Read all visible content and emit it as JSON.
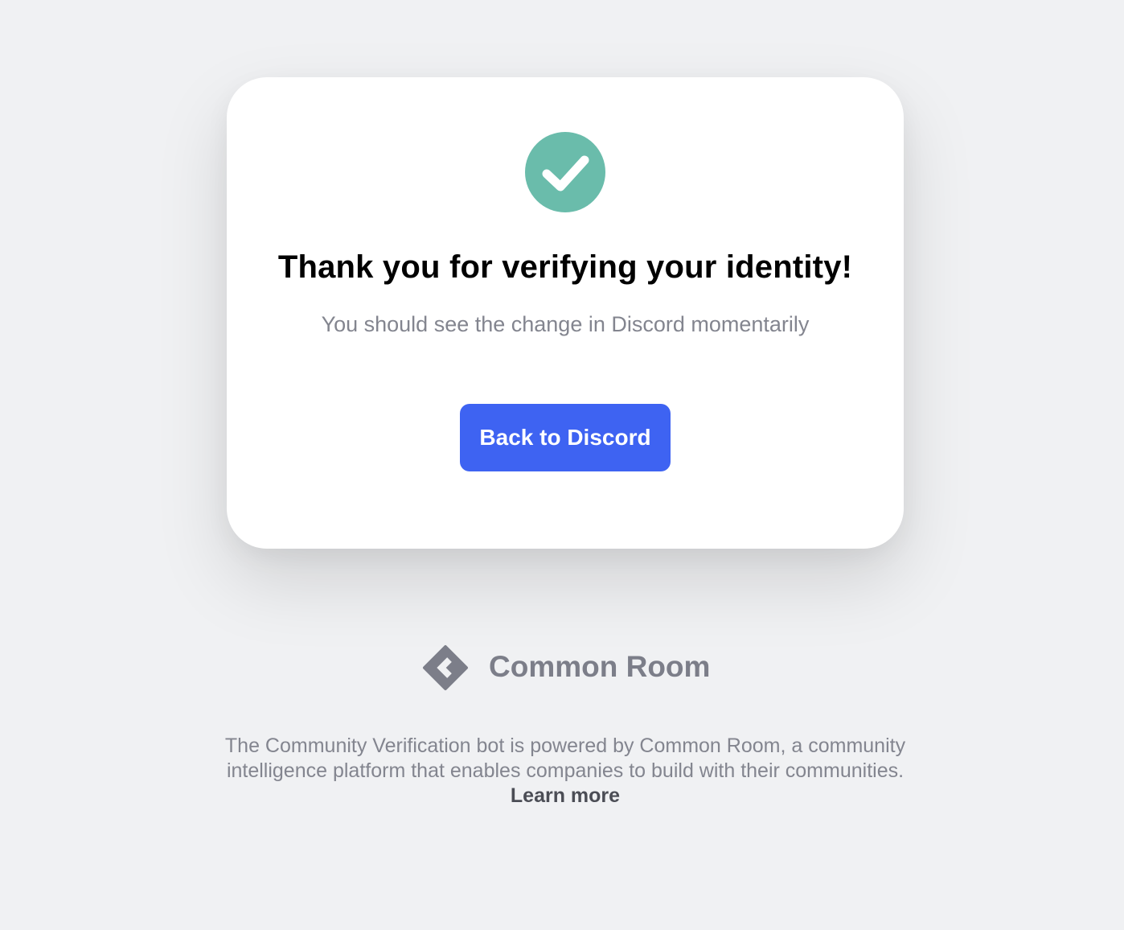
{
  "card": {
    "title": "Thank you for verifying your identity!",
    "subtitle": "You should see the change in Discord momentarily",
    "button_label": "Back to Discord",
    "success_icon": "check-circle-icon"
  },
  "brand": {
    "logo_icon": "common-room-logo-icon",
    "name": "Common Room"
  },
  "footer": {
    "line1": "The Community Verification bot is powered by Common Room, a community",
    "line2": "intelligence platform that enables companies to build with their communities.",
    "learn_more": "Learn more"
  },
  "colors": {
    "background": "#f0f1f3",
    "card": "#ffffff",
    "success": "#6abcab",
    "button": "#3e63f2",
    "muted_text": "#83858f",
    "brand_gray": "#7c7e89"
  }
}
